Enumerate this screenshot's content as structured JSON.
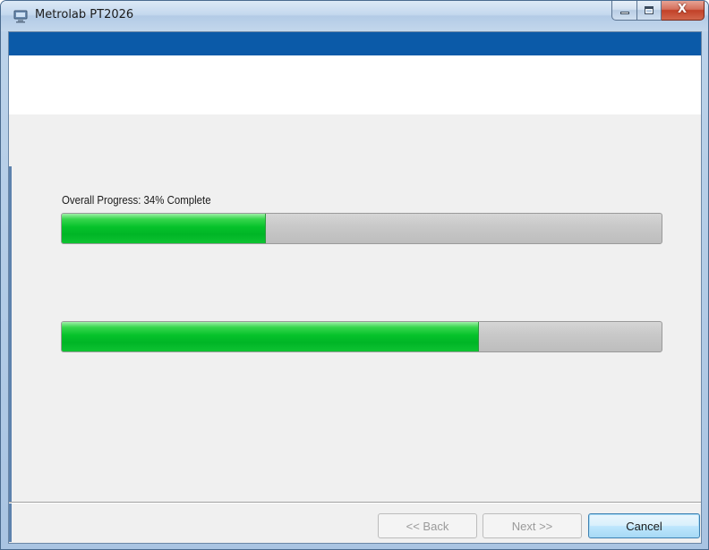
{
  "window": {
    "title": "Metrolab PT2026",
    "icons": {
      "app": "installer-icon",
      "minimize": "minimize-icon",
      "maximize": "maximize-icon",
      "close": "close-icon"
    },
    "close_glyph": "X"
  },
  "progress": {
    "overall_label": "Overall Progress: 34% Complete",
    "overall_fraction": 0.34,
    "step_fraction": 0.695,
    "fill_color": "#06c22b"
  },
  "footer": {
    "back_label": "<< Back",
    "next_label": "Next >>",
    "cancel_label": "Cancel"
  },
  "colors": {
    "header_bar": "#0b5aa8",
    "client_bg": "#f0f0f0"
  }
}
